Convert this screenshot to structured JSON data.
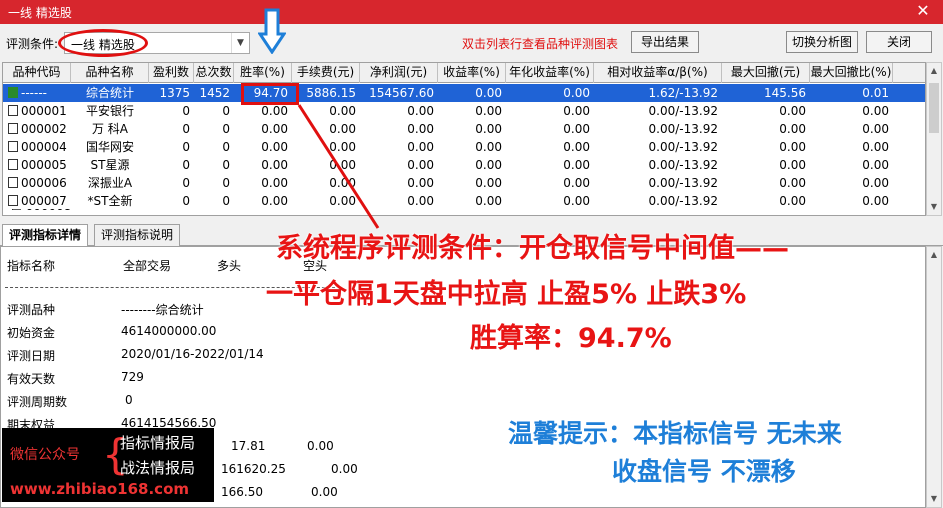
{
  "window": {
    "title": "一线 精选股",
    "close_glyph": "✕"
  },
  "toolbar": {
    "condition_label": "评测条件:",
    "condition_value": "一线 精选股",
    "hint": "双击列表行查看品种评测图表",
    "export_button": "导出结果",
    "switch_button": "切换分析图",
    "close_button": "关闭"
  },
  "grid": {
    "columns": [
      "品种代码",
      "品种名称",
      "盈利数",
      "总次数",
      "胜率(%)",
      "手续费(元)",
      "净利润(元)",
      "收益率(%)",
      "年化收益率(%)",
      "相对收益率α/β(%)",
      "最大回撤(元)",
      "最大回撤比(%)"
    ],
    "rows": [
      {
        "code": "------",
        "name": "综合统计",
        "win": "1375",
        "total": "1452",
        "rate": "94.70",
        "fee": "5886.15",
        "profit": "154567.60",
        "ret": "0.00",
        "annual": "0.00",
        "relative": "1.62/-13.92",
        "maxdd": "145.56",
        "maxddp": "0.01",
        "selected": true
      },
      {
        "code": "000001",
        "name": "平安银行",
        "win": "0",
        "total": "0",
        "rate": "0.00",
        "fee": "0.00",
        "profit": "0.00",
        "ret": "0.00",
        "annual": "0.00",
        "relative": "0.00/-13.92",
        "maxdd": "0.00",
        "maxddp": "0.00"
      },
      {
        "code": "000002",
        "name": "万 科A",
        "win": "0",
        "total": "0",
        "rate": "0.00",
        "fee": "0.00",
        "profit": "0.00",
        "ret": "0.00",
        "annual": "0.00",
        "relative": "0.00/-13.92",
        "maxdd": "0.00",
        "maxddp": "0.00"
      },
      {
        "code": "000004",
        "name": "国华网安",
        "win": "0",
        "total": "0",
        "rate": "0.00",
        "fee": "0.00",
        "profit": "0.00",
        "ret": "0.00",
        "annual": "0.00",
        "relative": "0.00/-13.92",
        "maxdd": "0.00",
        "maxddp": "0.00"
      },
      {
        "code": "000005",
        "name": "ST星源",
        "win": "0",
        "total": "0",
        "rate": "0.00",
        "fee": "0.00",
        "profit": "0.00",
        "ret": "0.00",
        "annual": "0.00",
        "relative": "0.00/-13.92",
        "maxdd": "0.00",
        "maxddp": "0.00"
      },
      {
        "code": "000006",
        "name": "深振业A",
        "win": "0",
        "total": "0",
        "rate": "0.00",
        "fee": "0.00",
        "profit": "0.00",
        "ret": "0.00",
        "annual": "0.00",
        "relative": "0.00/-13.92",
        "maxdd": "0.00",
        "maxddp": "0.00"
      },
      {
        "code": "000007",
        "name": "*ST全新",
        "win": "0",
        "total": "0",
        "rate": "0.00",
        "fee": "0.00",
        "profit": "0.00",
        "ret": "0.00",
        "annual": "0.00",
        "relative": "0.00/-13.92",
        "maxdd": "0.00",
        "maxddp": "0.00"
      }
    ]
  },
  "tabs": [
    "评测指标详情",
    "评测指标说明"
  ],
  "detail": {
    "headers": [
      "指标名称",
      "全部交易",
      "多头",
      "空头"
    ],
    "rows": [
      {
        "label": "评测品种",
        "value": "--------综合统计"
      },
      {
        "label": "初始资金",
        "value": "4614000000.00"
      },
      {
        "label": "评测日期",
        "value": "2020/01/16-2022/01/14"
      },
      {
        "label": "有效天数",
        "value": "729"
      },
      {
        "label": "评测周期数",
        "value": "0"
      },
      {
        "label": "期末权益",
        "value": "4614154566.50"
      }
    ],
    "partial": [
      {
        "v1": "17.81",
        "v2": "0.00"
      },
      {
        "v1": "161620.25",
        "v2": "0.00"
      },
      {
        "v1": "166.50",
        "v2": "0.00"
      }
    ]
  },
  "overlay": {
    "line1": "系统程序评测条件：开仓取信号中间值——",
    "line2": "一平仓隔1天盘中拉高  止盈5%  止跌3%",
    "line3": "胜算率：94.7%",
    "tip1": "温馨提示：本指标信号 无未来",
    "tip2": "收盘信号 不漂移",
    "colors": {
      "red": "#e81414",
      "blue": "#1e7fd8",
      "selection": "#1f63d6"
    }
  },
  "watermark": {
    "wechat": "微信公众号",
    "item1": "指标情报局",
    "item2": "战法情报局",
    "url": "www.zhibiao168.com"
  }
}
